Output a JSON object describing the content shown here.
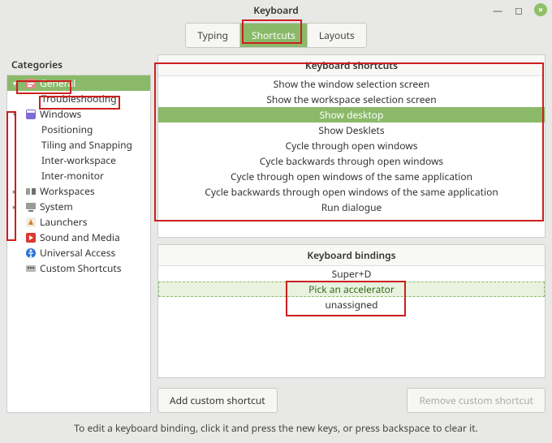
{
  "window": {
    "title": "Keyboard",
    "minimize_glyph": "—",
    "maximize_glyph": "◻",
    "close_glyph": "×"
  },
  "tabs": [
    {
      "label": "Typing",
      "active": false
    },
    {
      "label": "Shortcuts",
      "active": true
    },
    {
      "label": "Layouts",
      "active": false
    }
  ],
  "sidebar": {
    "header": "Categories",
    "items": [
      {
        "label": "General",
        "depth": 0,
        "arrow": "down",
        "icon": "general",
        "selected": true
      },
      {
        "label": "Troubleshooting",
        "depth": 1,
        "arrow": "",
        "icon": "",
        "selected": false
      },
      {
        "label": "Windows",
        "depth": 0,
        "arrow": "down",
        "icon": "windows",
        "selected": false
      },
      {
        "label": "Positioning",
        "depth": 1,
        "arrow": "",
        "icon": "",
        "selected": false
      },
      {
        "label": "Tiling and Snapping",
        "depth": 1,
        "arrow": "",
        "icon": "",
        "selected": false
      },
      {
        "label": "Inter-workspace",
        "depth": 1,
        "arrow": "",
        "icon": "",
        "selected": false
      },
      {
        "label": "Inter-monitor",
        "depth": 1,
        "arrow": "",
        "icon": "",
        "selected": false
      },
      {
        "label": "Workspaces",
        "depth": 0,
        "arrow": "right",
        "icon": "workspaces",
        "selected": false
      },
      {
        "label": "System",
        "depth": 0,
        "arrow": "right",
        "icon": "system",
        "selected": false
      },
      {
        "label": "Launchers",
        "depth": 0,
        "arrow": "",
        "icon": "launchers",
        "selected": false
      },
      {
        "label": "Sound and Media",
        "depth": 0,
        "arrow": "",
        "icon": "sound",
        "selected": false
      },
      {
        "label": "Universal Access",
        "depth": 0,
        "arrow": "",
        "icon": "access",
        "selected": false
      },
      {
        "label": "Custom Shortcuts",
        "depth": 0,
        "arrow": "",
        "icon": "custom",
        "selected": false
      }
    ]
  },
  "shortcuts": {
    "header": "Keyboard shortcuts",
    "rows": [
      {
        "label": "Show the window selection screen",
        "state": "normal"
      },
      {
        "label": "Show the workspace selection screen",
        "state": "normal"
      },
      {
        "label": "Show desktop",
        "state": "selected"
      },
      {
        "label": "Show Desklets",
        "state": "normal"
      },
      {
        "label": "Cycle through open windows",
        "state": "normal"
      },
      {
        "label": "Cycle backwards through open windows",
        "state": "normal"
      },
      {
        "label": "Cycle through open windows of the same application",
        "state": "normal"
      },
      {
        "label": "Cycle backwards through open windows of the same application",
        "state": "normal"
      },
      {
        "label": "Run dialogue",
        "state": "normal"
      }
    ]
  },
  "bindings": {
    "header": "Keyboard bindings",
    "rows": [
      {
        "label": "Super+D",
        "state": "normal"
      },
      {
        "label": "Pick an accelerator",
        "state": "highlight"
      },
      {
        "label": "unassigned",
        "state": "normal"
      }
    ]
  },
  "buttons": {
    "add": "Add custom shortcut",
    "remove": "Remove custom shortcut"
  },
  "footer": "To edit a keyboard binding, click it and press the new keys, or press backspace to clear it."
}
